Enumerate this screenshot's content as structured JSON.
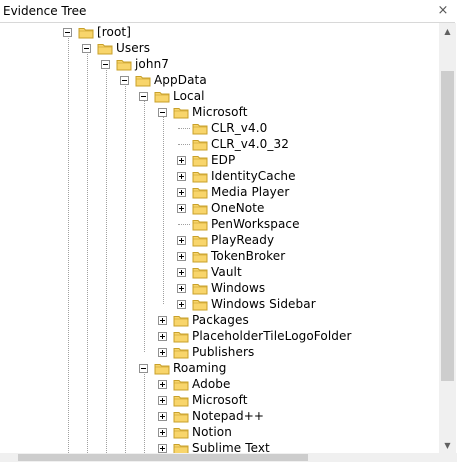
{
  "panel": {
    "title": "Evidence Tree",
    "close_glyph": "×"
  },
  "tree": [
    {
      "label": "[root]",
      "depth": 0,
      "state": "expanded"
    },
    {
      "label": "Users",
      "depth": 1,
      "state": "expanded"
    },
    {
      "label": "john7",
      "depth": 2,
      "state": "expanded"
    },
    {
      "label": "AppData",
      "depth": 3,
      "state": "expanded"
    },
    {
      "label": "Local",
      "depth": 4,
      "state": "expanded"
    },
    {
      "label": "Microsoft",
      "depth": 5,
      "state": "expanded"
    },
    {
      "label": "CLR_v4.0",
      "depth": 6,
      "state": "leaf"
    },
    {
      "label": "CLR_v4.0_32",
      "depth": 6,
      "state": "leaf"
    },
    {
      "label": "EDP",
      "depth": 6,
      "state": "collapsed"
    },
    {
      "label": "IdentityCache",
      "depth": 6,
      "state": "collapsed"
    },
    {
      "label": "Media Player",
      "depth": 6,
      "state": "collapsed"
    },
    {
      "label": "OneNote",
      "depth": 6,
      "state": "collapsed"
    },
    {
      "label": "PenWorkspace",
      "depth": 6,
      "state": "leaf"
    },
    {
      "label": "PlayReady",
      "depth": 6,
      "state": "collapsed"
    },
    {
      "label": "TokenBroker",
      "depth": 6,
      "state": "collapsed"
    },
    {
      "label": "Vault",
      "depth": 6,
      "state": "collapsed"
    },
    {
      "label": "Windows",
      "depth": 6,
      "state": "collapsed"
    },
    {
      "label": "Windows Sidebar",
      "depth": 6,
      "state": "collapsed"
    },
    {
      "label": "Packages",
      "depth": 5,
      "state": "collapsed"
    },
    {
      "label": "PlaceholderTileLogoFolder",
      "depth": 5,
      "state": "collapsed"
    },
    {
      "label": "Publishers",
      "depth": 5,
      "state": "collapsed"
    },
    {
      "label": "Roaming",
      "depth": 4,
      "state": "expanded"
    },
    {
      "label": "Adobe",
      "depth": 5,
      "state": "collapsed"
    },
    {
      "label": "Microsoft",
      "depth": 5,
      "state": "collapsed"
    },
    {
      "label": "Notepad++",
      "depth": 5,
      "state": "collapsed"
    },
    {
      "label": "Notion",
      "depth": 5,
      "state": "collapsed"
    },
    {
      "label": "Sublime Text",
      "depth": 5,
      "state": "collapsed"
    }
  ],
  "icons": {
    "folder": "folder-icon",
    "expand": "plus-expander-icon",
    "collapse": "minus-expander-icon",
    "close": "close-icon"
  },
  "colors": {
    "folder_fill": "#f8d56b",
    "folder_stroke": "#c8a02a",
    "tree_line": "#a0a0a0"
  }
}
